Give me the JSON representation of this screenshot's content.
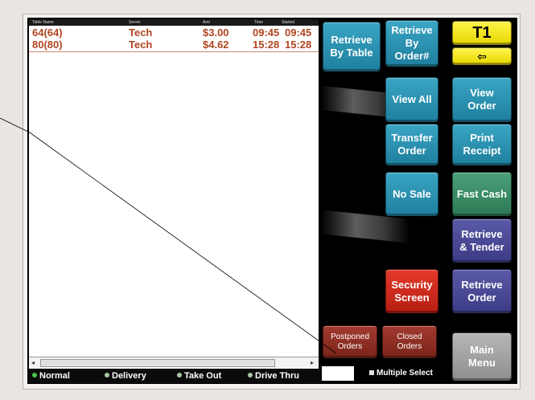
{
  "list": {
    "headers": [
      "Table Name",
      "Server",
      "Amt",
      "Time",
      "Started"
    ],
    "rows": [
      {
        "table": "64(64)",
        "server": "Tech",
        "amount": "$3.00",
        "time1": "09:45",
        "time2": "09:45"
      },
      {
        "table": "80(80)",
        "server": "Tech",
        "amount": "$4.62",
        "time1": "15:28",
        "time2": "15:28"
      }
    ]
  },
  "filters": {
    "normal": "Normal",
    "delivery": "Delivery",
    "takeout": "Take Out",
    "drivethru": "Drive Thru"
  },
  "multi_select": "Multiple Select",
  "buttons": {
    "retrieve_by_table": "Retrieve\nBy Table",
    "retrieve_by_order": "Retrieve\nBy\nOrder#",
    "terminal": "T1",
    "back_arrow": "⇦",
    "view_all": "View All",
    "view_order": "View\nOrder",
    "transfer_order": "Transfer\nOrder",
    "print_receipt": "Print\nReceipt",
    "no_sale": "No Sale",
    "fast_cash": "Fast Cash",
    "retrieve_tender": "Retrieve\n& Tender",
    "security_screen": "Security\nScreen",
    "retrieve_order": "Retrieve\nOrder",
    "postponed_orders": "Postponed\nOrders",
    "closed_orders": "Closed\nOrders",
    "main_menu": "Main\nMenu"
  },
  "colors": {
    "teal": "#2a93b3",
    "green": "#3a8d66",
    "purple": "#4a4a96",
    "red": "#d12b1d",
    "yellow": "#fff000"
  }
}
